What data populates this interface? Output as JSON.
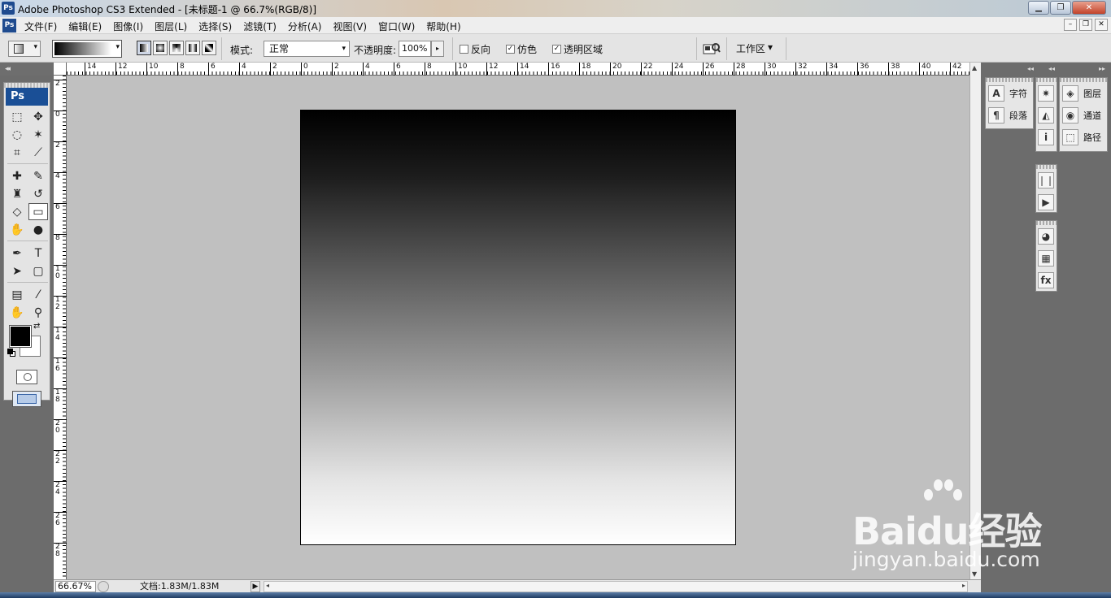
{
  "window": {
    "title": "Adobe Photoshop CS3 Extended - [未标题-1 @ 66.7%(RGB/8)]",
    "app_badge": "Ps",
    "buttons": {
      "minimize": "▁",
      "maximize": "❐",
      "close": "✕"
    }
  },
  "menu": {
    "items": [
      "文件(F)",
      "编辑(E)",
      "图像(I)",
      "图层(L)",
      "选择(S)",
      "滤镜(T)",
      "分析(A)",
      "视图(V)",
      "窗口(W)",
      "帮助(H)"
    ],
    "doc_buttons": {
      "minimize": "–",
      "restore": "❐",
      "close": "✕"
    }
  },
  "options": {
    "mode_label": "模式:",
    "mode_value": "正常",
    "opacity_label": "不透明度:",
    "opacity_value": "100%",
    "reverse_label": "反向",
    "reverse_checked": false,
    "dither_label": "仿色",
    "dither_checked": true,
    "transparency_label": "透明区域",
    "transparency_checked": true,
    "workspace_label": "工作区",
    "dropdown_glyph": "▾",
    "spin_glyph": "▸",
    "check_glyph": "✓"
  },
  "panel_grips": {
    "left": "◂◂",
    "right_a": "◂◂",
    "right_b": "◂◂",
    "right_c": "▸▸"
  },
  "toolbox": {
    "badge": "Ps",
    "tools": [
      {
        "name": "marquee-tool",
        "glyph": "⬚"
      },
      {
        "name": "move-tool",
        "glyph": "✥"
      },
      {
        "name": "lasso-tool",
        "glyph": "◌"
      },
      {
        "name": "magic-wand-tool",
        "glyph": "✶"
      },
      {
        "name": "crop-tool",
        "glyph": "⌗"
      },
      {
        "name": "slice-tool",
        "glyph": "⟋"
      },
      {
        "name": "healing-brush-tool",
        "glyph": "✚"
      },
      {
        "name": "brush-tool",
        "glyph": "✎"
      },
      {
        "name": "clone-stamp-tool",
        "glyph": "♜"
      },
      {
        "name": "history-brush-tool",
        "glyph": "↺"
      },
      {
        "name": "eraser-tool",
        "glyph": "◇"
      },
      {
        "name": "gradient-tool",
        "glyph": "▭",
        "selected": true
      },
      {
        "name": "blur-tool",
        "glyph": "✋"
      },
      {
        "name": "dodge-tool",
        "glyph": "●"
      },
      {
        "name": "pen-tool",
        "glyph": "✒"
      },
      {
        "name": "type-tool",
        "glyph": "T"
      },
      {
        "name": "path-selection-tool",
        "glyph": "➤"
      },
      {
        "name": "shape-tool",
        "glyph": "▢"
      },
      {
        "name": "notes-tool",
        "glyph": "▤"
      },
      {
        "name": "eyedropper-tool",
        "glyph": "⁄"
      },
      {
        "name": "hand-tool",
        "glyph": "✋"
      },
      {
        "name": "zoom-tool",
        "glyph": "⚲"
      }
    ],
    "swap_glyph": "⇄",
    "foreground_color": "#000000",
    "background_color": "#ffffff"
  },
  "rulers": {
    "horizontal": [
      "14",
      "12",
      "10",
      "8",
      "6",
      "4",
      "2",
      "0",
      "2",
      "4",
      "6",
      "8",
      "10",
      "12",
      "14",
      "16",
      "18",
      "20",
      "22",
      "24",
      "26",
      "28",
      "30",
      "32",
      "34",
      "36",
      "38",
      "40",
      "42"
    ],
    "vertical": [
      "2",
      "0",
      "2",
      "4",
      "6",
      "8",
      "1\n0",
      "1\n2",
      "1\n4",
      "1\n6",
      "1\n8",
      "2\n0",
      "2\n2",
      "2\n4",
      "2\n6",
      "2\n8"
    ]
  },
  "scroll_arrows": {
    "up": "▲",
    "down": "▼",
    "left": "◂",
    "right": "▸"
  },
  "status": {
    "zoom": "66.67%",
    "doc_info": "文档:1.83M/1.83M",
    "menu_arrow": "▶"
  },
  "right_panels": {
    "group1": [
      {
        "icon": "A",
        "label": "字符"
      },
      {
        "icon": "¶",
        "label": "段落"
      }
    ],
    "group2_icons": [
      "✷",
      "◭",
      "i"
    ],
    "group3_icons": [
      "❘❘",
      "▶"
    ],
    "group4_icons": [
      "◕",
      "▦",
      "fx"
    ],
    "group5": [
      {
        "icon": "◈",
        "label": "图层"
      },
      {
        "icon": "◉",
        "label": "通道"
      },
      {
        "icon": "⬚",
        "label": "路径"
      }
    ]
  },
  "watermark": {
    "brand": "Baidu经验",
    "url": "jingyan.baidu.com"
  }
}
